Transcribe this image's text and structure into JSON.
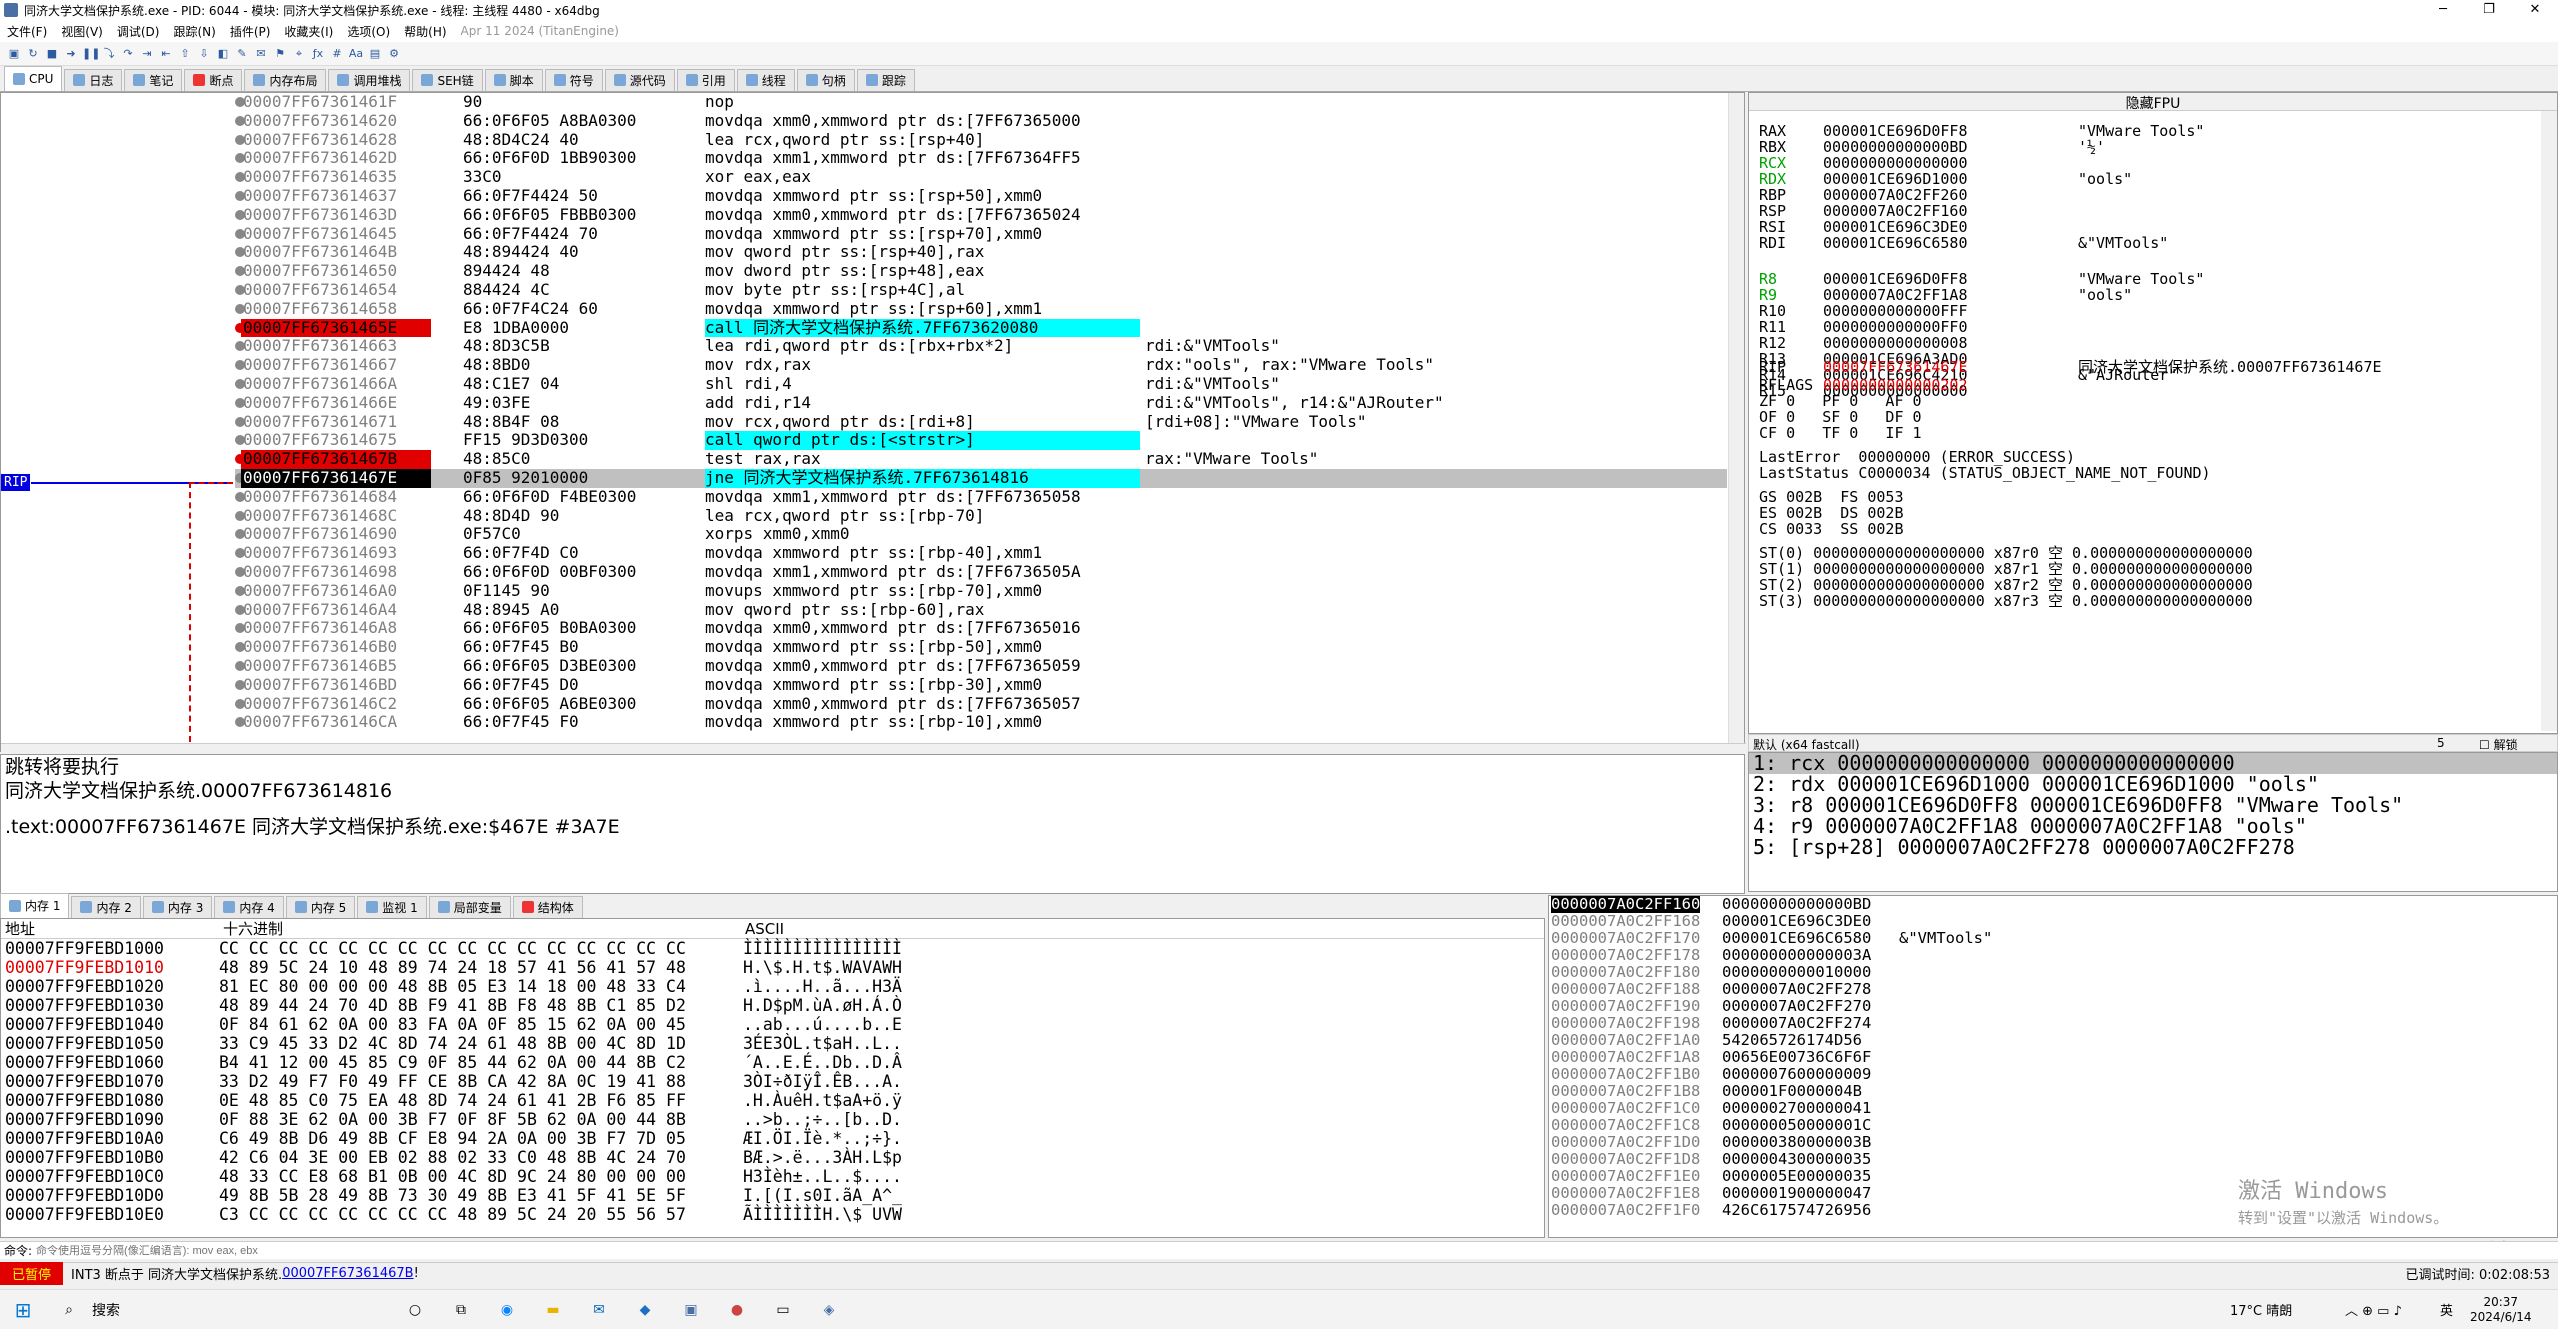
{
  "title_bar": {
    "title": "同济大学文档保护系统.exe - PID: 6044 - 模块: 同济大学文档保护系统.exe - 线程: 主线程 4480 - x64dbg"
  },
  "menu": {
    "items": [
      "文件(F)",
      "视图(V)",
      "调试(D)",
      "跟踪(N)",
      "插件(P)",
      "收藏夹(I)",
      "选项(O)",
      "帮助(H)"
    ],
    "build_date": "Apr 11 2024 (TitanEngine)"
  },
  "tabs": [
    "CPU",
    "日志",
    "笔记",
    "断点",
    "内存布局",
    "调用堆栈",
    "SEH链",
    "脚本",
    "符号",
    "源代码",
    "引用",
    "线程",
    "句柄",
    "跟踪"
  ],
  "rip_label": "RIP",
  "disasm": [
    {
      "addr": "00007FF67361461F",
      "bytes": "90",
      "ins": "nop",
      "cmt": ""
    },
    {
      "addr": "00007FF673614620",
      "bytes": "66:0F6F05 A8BA0300",
      "ins": "movdqa xmm0,xmmword ptr ds:[7FF67365000",
      "cmt": ""
    },
    {
      "addr": "00007FF673614628",
      "bytes": "48:8D4C24 40",
      "ins": "lea rcx,qword ptr ss:[rsp+40]",
      "cmt": ""
    },
    {
      "addr": "00007FF67361462D",
      "bytes": "66:0F6F0D 1BB90300",
      "ins": "movdqa xmm1,xmmword ptr ds:[7FF67364FF5",
      "cmt": ""
    },
    {
      "addr": "00007FF673614635",
      "bytes": "33C0",
      "ins": "xor eax,eax",
      "cmt": ""
    },
    {
      "addr": "00007FF673614637",
      "bytes": "66:0F7F4424 50",
      "ins": "movdqa xmmword ptr ss:[rsp+50],xmm0",
      "cmt": ""
    },
    {
      "addr": "00007FF67361463D",
      "bytes": "66:0F6F05 FBBB0300",
      "ins": "movdqa xmm0,xmmword ptr ds:[7FF67365024",
      "cmt": ""
    },
    {
      "addr": "00007FF673614645",
      "bytes": "66:0F7F4424 70",
      "ins": "movdqa xmmword ptr ss:[rsp+70],xmm0",
      "cmt": ""
    },
    {
      "addr": "00007FF67361464B",
      "bytes": "48:894424 40",
      "ins": "mov qword ptr ss:[rsp+40],rax",
      "cmt": ""
    },
    {
      "addr": "00007FF673614650",
      "bytes": "894424 48",
      "ins": "mov dword ptr ss:[rsp+48],eax",
      "cmt": ""
    },
    {
      "addr": "00007FF673614654",
      "bytes": "884424 4C",
      "ins": "mov byte ptr ss:[rsp+4C],al",
      "cmt": ""
    },
    {
      "addr": "00007FF673614658",
      "bytes": "66:0F7F4C24 60",
      "ins": "movdqa xmmword ptr ss:[rsp+60],xmm1",
      "cmt": ""
    },
    {
      "addr": "00007FF67361465E",
      "bytes": "E8 1DBA0000",
      "ins": "call 同济大学文档保护系统.7FF673620080",
      "cmt": ""
    },
    {
      "addr": "00007FF673614663",
      "bytes": "48:8D3C5B",
      "ins": "lea rdi,qword ptr ds:[rbx+rbx*2]",
      "cmt": "rdi:&\"VMTools\""
    },
    {
      "addr": "00007FF673614667",
      "bytes": "48:8BD0",
      "ins": "mov rdx,rax",
      "cmt": "rdx:\"ools\", rax:\"VMware Tools\""
    },
    {
      "addr": "00007FF67361466A",
      "bytes": "48:C1E7 04",
      "ins": "shl rdi,4",
      "cmt": "rdi:&\"VMTools\""
    },
    {
      "addr": "00007FF67361466E",
      "bytes": "49:03FE",
      "ins": "add rdi,r14",
      "cmt": "rdi:&\"VMTools\", r14:&\"AJRouter\""
    },
    {
      "addr": "00007FF673614671",
      "bytes": "48:8B4F 08",
      "ins": "mov rcx,qword ptr ds:[rdi+8]",
      "cmt": "[rdi+08]:\"VMware Tools\""
    },
    {
      "addr": "00007FF673614675",
      "bytes": "FF15 9D3D0300",
      "ins": "call qword ptr ds:[<strstr>]",
      "cmt": ""
    },
    {
      "addr": "00007FF67361467B",
      "bytes": "48:85C0",
      "ins": "test rax,rax",
      "cmt": "rax:\"VMware Tools\""
    },
    {
      "addr": "00007FF67361467E",
      "bytes": "0F85 92010000",
      "ins": "jne 同济大学文档保护系统.7FF673614816",
      "cmt": ""
    },
    {
      "addr": "00007FF673614684",
      "bytes": "66:0F6F0D F4BE0300",
      "ins": "movdqa xmm1,xmmword ptr ds:[7FF67365058",
      "cmt": ""
    },
    {
      "addr": "00007FF67361468C",
      "bytes": "48:8D4D 90",
      "ins": "lea rcx,qword ptr ss:[rbp-70]",
      "cmt": ""
    },
    {
      "addr": "00007FF673614690",
      "bytes": "0F57C0",
      "ins": "xorps xmm0,xmm0",
      "cmt": ""
    },
    {
      "addr": "00007FF673614693",
      "bytes": "66:0F7F4D C0",
      "ins": "movdqa xmmword ptr ss:[rbp-40],xmm1",
      "cmt": ""
    },
    {
      "addr": "00007FF673614698",
      "bytes": "66:0F6F0D 00BF0300",
      "ins": "movdqa xmm1,xmmword ptr ds:[7FF6736505A",
      "cmt": ""
    },
    {
      "addr": "00007FF6736146A0",
      "bytes": "0F1145 90",
      "ins": "movups xmmword ptr ss:[rbp-70],xmm0",
      "cmt": ""
    },
    {
      "addr": "00007FF6736146A4",
      "bytes": "48:8945 A0",
      "ins": "mov qword ptr ss:[rbp-60],rax",
      "cmt": ""
    },
    {
      "addr": "00007FF6736146A8",
      "bytes": "66:0F6F05 B0BA0300",
      "ins": "movdqa xmm0,xmmword ptr ds:[7FF67365016",
      "cmt": ""
    },
    {
      "addr": "00007FF6736146B0",
      "bytes": "66:0F7F45 B0",
      "ins": "movdqa xmmword ptr ss:[rbp-50],xmm0",
      "cmt": ""
    },
    {
      "addr": "00007FF6736146B5",
      "bytes": "66:0F6F05 D3BE0300",
      "ins": "movdqa xmm0,xmmword ptr ds:[7FF67365059",
      "cmt": ""
    },
    {
      "addr": "00007FF6736146BD",
      "bytes": "66:0F7F45 D0",
      "ins": "movdqa xmmword ptr ss:[rbp-30],xmm0",
      "cmt": ""
    },
    {
      "addr": "00007FF6736146C2",
      "bytes": "66:0F6F05 A6BE0300",
      "ins": "movdqa xmm0,xmmword ptr ds:[7FF67365057",
      "cmt": ""
    },
    {
      "addr": "00007FF6736146CA",
      "bytes": "66:0F7F45 F0",
      "ins": "movdqa xmmword ptr ss:[rbp-10],xmm0",
      "cmt": ""
    }
  ],
  "info": {
    "line1": "跳转将要执行",
    "line2": "同济大学文档保护系统.00007FF673614816",
    "line3": ".text:00007FF67361467E 同济大学文档保护系统.exe:$467E #3A7E"
  },
  "regs": {
    "header": "隐藏FPU",
    "gpr": [
      {
        "n": "RAX",
        "v": "000001CE696D0FF8",
        "c": "\"VMware Tools\""
      },
      {
        "n": "RBX",
        "v": "00000000000000BD",
        "c": "'½'"
      },
      {
        "n": "RCX",
        "v": "0000000000000000",
        "c": ""
      },
      {
        "n": "RDX",
        "v": "000001CE696D1000",
        "c": "\"ools\""
      },
      {
        "n": "RBP",
        "v": "0000007A0C2FF260",
        "c": ""
      },
      {
        "n": "RSP",
        "v": "0000007A0C2FF160",
        "c": ""
      },
      {
        "n": "RSI",
        "v": "000001CE696C3DE0",
        "c": ""
      },
      {
        "n": "RDI",
        "v": "000001CE696C6580",
        "c": "&\"VMTools\""
      }
    ],
    "ext": [
      {
        "n": "R8",
        "v": "000001CE696D0FF8",
        "c": "\"VMware Tools\""
      },
      {
        "n": "R9",
        "v": "0000007A0C2FF1A8",
        "c": "\"ools\""
      },
      {
        "n": "R10",
        "v": "0000000000000FFF",
        "c": ""
      },
      {
        "n": "R11",
        "v": "0000000000000FF0",
        "c": ""
      },
      {
        "n": "R12",
        "v": "0000000000000008",
        "c": ""
      },
      {
        "n": "R13",
        "v": "000001CE696A3AD0",
        "c": ""
      },
      {
        "n": "R14",
        "v": "000001CE696C4210",
        "c": "&\"AJRouter\""
      },
      {
        "n": "R15",
        "v": "0000000000000000",
        "c": ""
      }
    ],
    "rip": {
      "n": "RIP",
      "v": "00007FF67361467E",
      "c": "同济大学文档保护系统.00007FF67361467E"
    },
    "rflags": {
      "n": "RFLAGS",
      "v": "0000000000000202"
    },
    "flags1": "ZF 0   PF 0   AF 0",
    "flags2": "OF 0   SF 0   DF 0",
    "flags3": "CF 0   TF 0   IF 1",
    "lasterror": "LastError  00000000 (ERROR_SUCCESS)",
    "laststatus": "LastStatus C0000034 (STATUS_OBJECT_NAME_NOT_FOUND)",
    "seg1": "GS 002B  FS 0053",
    "seg2": "ES 002B  DS 002B",
    "seg3": "CS 0033  SS 002B",
    "fpu": [
      "ST(0) 0000000000000000000 x87r0 空 0.000000000000000000",
      "ST(1) 0000000000000000000 x87r1 空 0.000000000000000000",
      "ST(2) 0000000000000000000 x87r2 空 0.000000000000000000",
      "ST(3) 0000000000000000000 x87r3 空 0.000000000000000000"
    ]
  },
  "callconv": {
    "label": "默认 (x64 fastcall)",
    "count": "5",
    "unlock": "解锁"
  },
  "args": [
    "1: rcx 0000000000000000 0000000000000000",
    "2: rdx 000001CE696D1000 000001CE696D1000 \"ools\"",
    "3: r8 000001CE696D0FF8 000001CE696D0FF8 \"VMware Tools\"",
    "4: r9 0000007A0C2FF1A8 0000007A0C2FF1A8 \"ools\"",
    "5: [rsp+28] 0000007A0C2FF278 0000007A0C2FF278"
  ],
  "memtabs": [
    "内存 1",
    "内存 2",
    "内存 3",
    "内存 4",
    "内存 5",
    "监视 1",
    "局部变量",
    "结构体"
  ],
  "dump": {
    "head_addr": "地址",
    "head_hex": "十六进制",
    "head_ascii": "ASCII",
    "rows": [
      {
        "a": "00007FF9FEBD1000",
        "h": "CC CC CC CC CC CC CC CC CC CC CC CC CC CC CC CC",
        "s": "ÌÌÌÌÌÌÌÌÌÌÌÌÌÌÌÌ"
      },
      {
        "a": "00007FF9FEBD1010",
        "h": "48 89 5C 24 10 48 89 74 24 18 57 41 56 41 57 48",
        "s": "H.\\$.H.t$.WAVAWH"
      },
      {
        "a": "00007FF9FEBD1020",
        "h": "81 EC 80 00 00 00 48 8B 05 E3 14 18 00 48 33 C4",
        "s": ".ì....H..ã...H3Ä"
      },
      {
        "a": "00007FF9FEBD1030",
        "h": "48 89 44 24 70 4D 8B F9 41 8B F8 48 8B C1 85 D2",
        "s": "H.D$pM.ùA.øH.Á.Ò"
      },
      {
        "a": "00007FF9FEBD1040",
        "h": "0F 84 61 62 0A 00 83 FA 0A 0F 85 15 62 0A 00 45",
        "s": "..ab...ú....b..E"
      },
      {
        "a": "00007FF9FEBD1050",
        "h": "33 C9 45 33 D2 4C 8D 74 24 61 48 8B 00 4C 8D 1D",
        "s": "3ÉE3ÒL.t$aH..L.."
      },
      {
        "a": "00007FF9FEBD1060",
        "h": "B4 41 12 00 45 85 C9 0F 85 44 62 0A 00 44 8B C2",
        "s": "´A..E.É..Db..D.Â"
      },
      {
        "a": "00007FF9FEBD1070",
        "h": "33 D2 49 F7 F0 49 FF CE 8B CA 42 8A 0C 19 41 88",
        "s": "3ÒI÷ðIÿÎ.ÊB...A."
      },
      {
        "a": "00007FF9FEBD1080",
        "h": "0E 48 85 C0 75 EA 48 8D 74 24 61 41 2B F6 85 FF",
        "s": ".H.ÀuêH.t$aA+ö.ÿ"
      },
      {
        "a": "00007FF9FEBD1090",
        "h": "0F 88 3E 62 0A 00 3B F7 0F 8F 5B 62 0A 00 44 8B",
        "s": "..>b..;÷..[b..D."
      },
      {
        "a": "00007FF9FEBD10A0",
        "h": "C6 49 8B D6 49 8B CF E8 94 2A 0A 00 3B F7 7D 05",
        "s": "ÆI.ÖI.Ïè.*..;÷}."
      },
      {
        "a": "00007FF9FEBD10B0",
        "h": "42 C6 04 3E 00 EB 02 88 02 33 C0 48 8B 4C 24 70",
        "s": "BÆ.>.ë...3ÀH.L$p"
      },
      {
        "a": "00007FF9FEBD10C0",
        "h": "48 33 CC E8 68 B1 0B 00 4C 8D 9C 24 80 00 00 00",
        "s": "H3Ìèh±..L..$...."
      },
      {
        "a": "00007FF9FEBD10D0",
        "h": "49 8B 5B 28 49 8B 73 30 49 8B E3 41 5F 41 5E 5F",
        "s": "I.[(I.s0I.ãA_A^_"
      },
      {
        "a": "00007FF9FEBD10E0",
        "h": "C3 CC CC CC CC CC CC CC 48 89 5C 24 20 55 56 57",
        "s": "ÃÌÌÌÌÌÌÌH.\\$ UVW"
      }
    ]
  },
  "stack": {
    "rows": [
      {
        "a": "0000007A0C2FF160",
        "v": "00000000000000BD",
        "c": ""
      },
      {
        "a": "0000007A0C2FF168",
        "v": "000001CE696C3DE0",
        "c": ""
      },
      {
        "a": "0000007A0C2FF170",
        "v": "000001CE696C6580",
        "c": "&\"VMTools\""
      },
      {
        "a": "0000007A0C2FF178",
        "v": "000000000000003A",
        "c": ""
      },
      {
        "a": "0000007A0C2FF180",
        "v": "0000000000010000",
        "c": ""
      },
      {
        "a": "0000007A0C2FF188",
        "v": "0000007A0C2FF278",
        "c": ""
      },
      {
        "a": "0000007A0C2FF190",
        "v": "0000007A0C2FF270",
        "c": ""
      },
      {
        "a": "0000007A0C2FF198",
        "v": "0000007A0C2FF274",
        "c": ""
      },
      {
        "a": "0000007A0C2FF1A0",
        "v": "542065726174D56",
        "c": ""
      },
      {
        "a": "0000007A0C2FF1A8",
        "v": "00656E00736C6F6F",
        "c": ""
      },
      {
        "a": "0000007A0C2FF1B0",
        "v": "0000007600000009",
        "c": ""
      },
      {
        "a": "0000007A0C2FF1B8",
        "v": "000001F0000004B",
        "c": ""
      },
      {
        "a": "0000007A0C2FF1C0",
        "v": "0000002700000041",
        "c": ""
      },
      {
        "a": "0000007A0C2FF1C8",
        "v": "000000050000001C",
        "c": ""
      },
      {
        "a": "0000007A0C2FF1D0",
        "v": "000000380000003B",
        "c": ""
      },
      {
        "a": "0000007A0C2FF1D8",
        "v": "0000004300000035",
        "c": ""
      },
      {
        "a": "0000007A0C2FF1E0",
        "v": "0000005E00000035",
        "c": ""
      },
      {
        "a": "0000007A0C2FF1E8",
        "v": "0000001900000047",
        "c": ""
      },
      {
        "a": "0000007A0C2FF1F0",
        "v": "426C617574726956",
        "c": ""
      }
    ],
    "footer": "默认"
  },
  "watermark": {
    "line1": "激活 Windows",
    "line2": "转到\"设置\"以激活 Windows。"
  },
  "cmdbar": {
    "label": "命令:",
    "placeholder": "命令使用逗号分隔(像汇编语言): mov eax, ebx"
  },
  "status": {
    "paused": "已暂停",
    "msg": "INT3 断点于 同济大学文档保护系统.",
    "link": "00007FF67361467B",
    "tail": "!",
    "time": "已调试时间: 0:02:08:53"
  },
  "taskbar": {
    "search": "搜索",
    "weather": "17°C  晴朗",
    "lang": "英",
    "time": "20:37",
    "date": "2024/6/14"
  }
}
